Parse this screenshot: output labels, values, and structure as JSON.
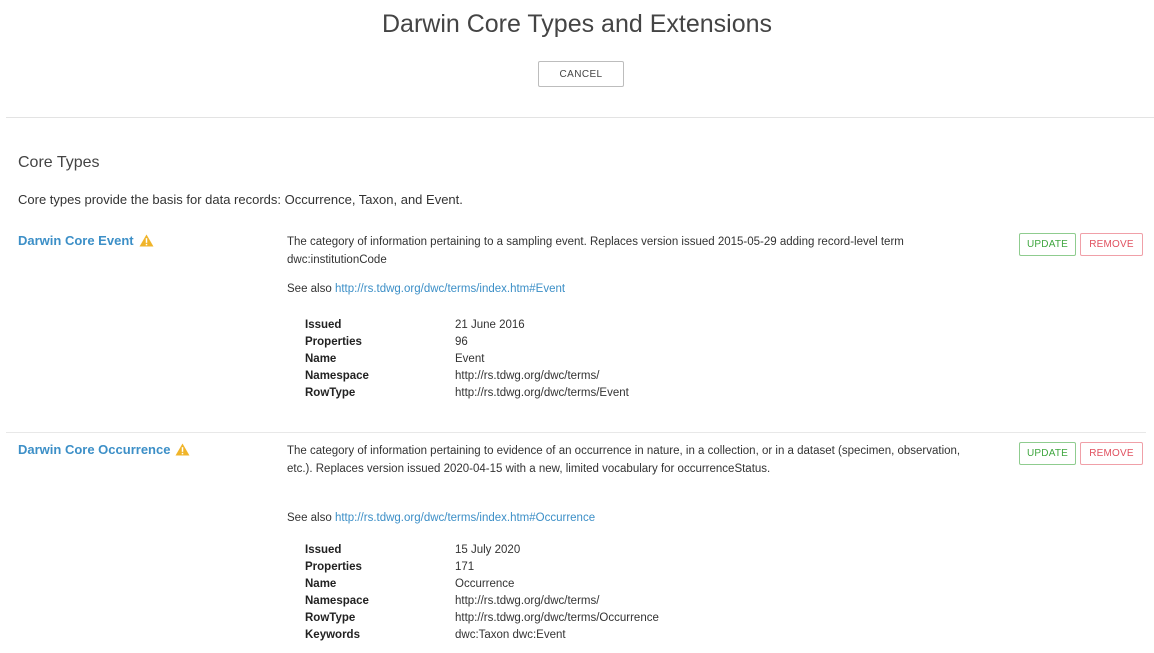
{
  "page": {
    "title": "Darwin Core Types and Extensions",
    "cancel_label": "CANCEL"
  },
  "section": {
    "title": "Core Types",
    "description": "Core types provide the basis for data records: Occurrence, Taxon, and Event."
  },
  "buttons": {
    "update_label": "UPDATE",
    "remove_label": "REMOVE"
  },
  "extensions": [
    {
      "name": "Darwin Core Event",
      "warning_icon": "warning-triangle-icon",
      "description": "The category of information pertaining to a sampling event. Replaces version issued 2015-05-29 adding record-level term dwc:institutionCode",
      "see_also_label": "See also",
      "see_also_link": "http://rs.tdwg.org/dwc/terms/index.htm#Event",
      "properties": [
        {
          "key": "Issued",
          "value": "21 June 2016"
        },
        {
          "key": "Properties",
          "value": "96"
        },
        {
          "key": "Name",
          "value": "Event"
        },
        {
          "key": "Namespace",
          "value": "http://rs.tdwg.org/dwc/terms/"
        },
        {
          "key": "RowType",
          "value": "http://rs.tdwg.org/dwc/terms/Event"
        }
      ]
    },
    {
      "name": "Darwin Core Occurrence",
      "warning_icon": "warning-triangle-icon",
      "description": "The category of information pertaining to evidence of an occurrence in nature, in a collection, or in a dataset (specimen, observation, etc.). Replaces version issued 2020-04-15 with a new, limited vocabulary for occurrenceStatus.",
      "see_also_label": "See also",
      "see_also_link": "http://rs.tdwg.org/dwc/terms/index.htm#Occurrence",
      "properties": [
        {
          "key": "Issued",
          "value": "15 July 2020"
        },
        {
          "key": "Properties",
          "value": "171"
        },
        {
          "key": "Name",
          "value": "Occurrence"
        },
        {
          "key": "Namespace",
          "value": "http://rs.tdwg.org/dwc/terms/"
        },
        {
          "key": "RowType",
          "value": "http://rs.tdwg.org/dwc/terms/Occurrence"
        },
        {
          "key": "Keywords",
          "value": "dwc:Taxon dwc:Event"
        }
      ]
    }
  ],
  "colors": {
    "link": "#3c8fc7",
    "warning": "#f0b429",
    "update": "#3fa63f",
    "remove": "#e0505f"
  }
}
